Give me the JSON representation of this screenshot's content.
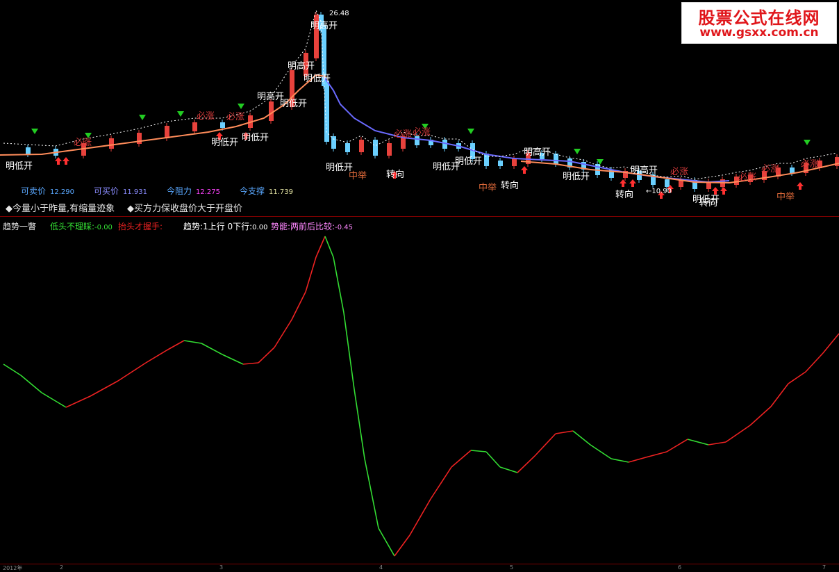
{
  "watermark": {
    "title": "股票公式在线网",
    "url": "www.gsxx.com.cn"
  },
  "price_panel": {
    "peak_price": "26.48",
    "low_marker": "←10.90",
    "info": [
      {
        "label": "可卖价",
        "value": "12.290",
        "color": "#5aa8ff"
      },
      {
        "label": "可买价",
        "value": "11.931",
        "color": "#8a8cff"
      },
      {
        "label": "今阻力",
        "value": "12.275",
        "color": "#5aa8ff",
        "value_color": "#ff44ff"
      },
      {
        "label": "今支撑",
        "value": "11.739",
        "color": "#5aa8ff",
        "value_color": "#e0e0a0"
      }
    ],
    "conditions": [
      "◆今量小于昨量,有缩量迹象",
      "◆买方力保收盘价大于开盘价"
    ],
    "signal_labels": [
      {
        "text": "明低开",
        "color": "#ffffff"
      },
      {
        "text": "明高开",
        "color": "#ffffff"
      },
      {
        "text": "转向",
        "color": "#ffffff"
      },
      {
        "text": "中举",
        "color": "#e06a3a"
      },
      {
        "text": "必涨",
        "color": "#d43a3a"
      }
    ]
  },
  "indicator_panel": {
    "title": "趋势一瞥",
    "legend": [
      {
        "label": "低头不理睬:",
        "value": "-0.00",
        "color": "#33dd33"
      },
      {
        "label": "抬头才握手:",
        "value": "",
        "color": "#ee2222"
      },
      {
        "label": "趋势:1上行 0下行:",
        "value": "0.00",
        "color": "#ffffff"
      },
      {
        "label": "势能:两前后比较:",
        "value": "-0.45",
        "color": "#ff88ff"
      }
    ],
    "colors": {
      "rising": "#ee2222",
      "falling": "#33dd33"
    }
  },
  "time_axis": {
    "labels": [
      "2012年",
      "2",
      "3",
      "4",
      "5",
      "6",
      "7"
    ]
  },
  "colors": {
    "ma_short": "#ff8c5a",
    "ma_long": "#6a6aff",
    "candle_up": "#e8423c",
    "candle_down": "#6ad0ff",
    "buy_arrow": "#ff3030",
    "sell_triangle": "#22cc22"
  }
}
